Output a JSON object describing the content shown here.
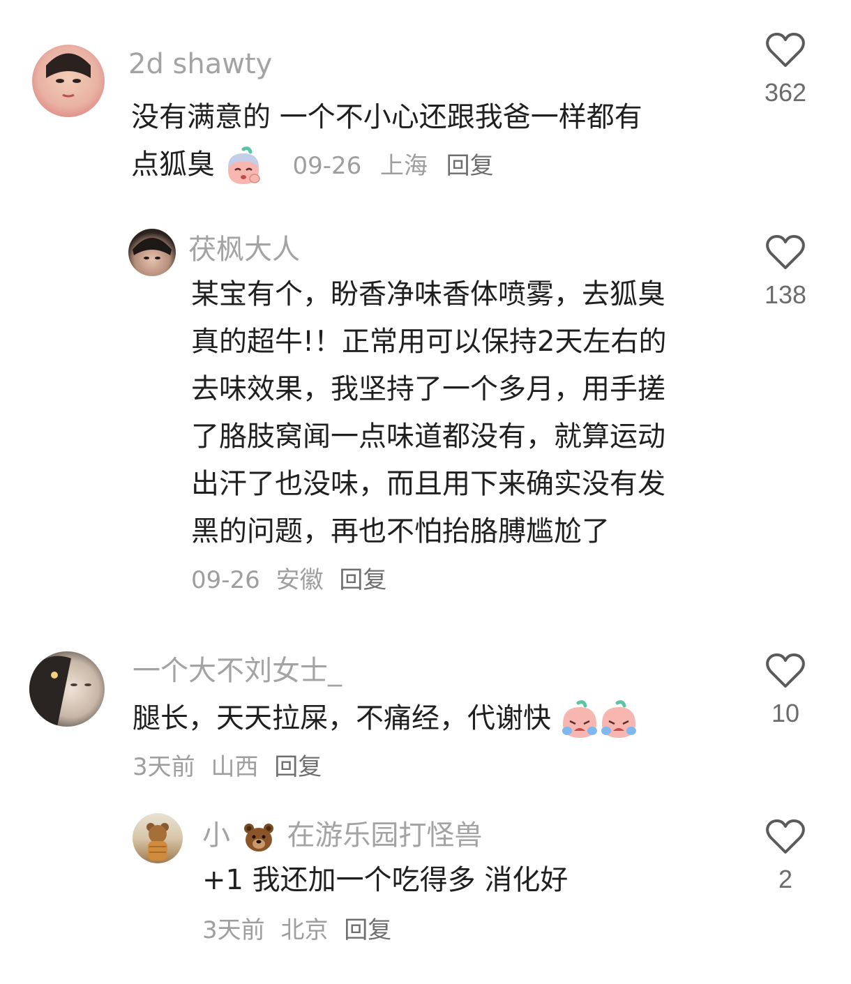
{
  "comments": [
    {
      "username": "2d shawty",
      "text": "没有满意的 一个不小心还跟我爸一样都有点狐臭",
      "text_line1": "没有满意的 一个不小心还跟我爸一样都有",
      "text_line2": "点狐臭",
      "emoji": "tired-face-emoji",
      "date": "09-26",
      "location": "上海",
      "reply_label": "回复",
      "likes": "362",
      "avatar_color": "#e9b2a4"
    },
    {
      "username": "茯枫大人",
      "text_lines": [
        "某宝有个，盼香净味香体喷雾，去狐臭",
        "真的超牛!！正常用可以保持2天左右的",
        "去味效果，我坚持了一个多月，用手搓",
        "了胳肢窝闻一点味道都没有，就算运动",
        "出汗了也没味，而且用下来确实没有发",
        "黑的问题，再也不怕抬胳膊尴尬了"
      ],
      "date": "09-26",
      "location": "安徽",
      "reply_label": "回复",
      "likes": "138",
      "avatar_color": "#3a2f2a"
    },
    {
      "username": "一个大不刘女士_",
      "text": "腿长，天天拉屎，不痛经，代谢快",
      "emoji": "crying-face-emoji",
      "date": "3天前",
      "location": "山西",
      "reply_label": "回复",
      "likes": "10",
      "avatar_color": "#c8b7a8"
    },
    {
      "username_prefix": "小",
      "username_emoji": "bear-emoji",
      "username_suffix": "在游乐园打怪兽",
      "text": "+1 我还加一个吃得多 消化好",
      "date": "3天前",
      "location": "北京",
      "reply_label": "回复",
      "likes": "2",
      "avatar_color": "#b68a5e"
    }
  ],
  "colors": {
    "username": "#a3a3a3",
    "body": "#1f1f1f",
    "meta": "#9e9e9e",
    "like_icon": "#5a5a5a"
  }
}
